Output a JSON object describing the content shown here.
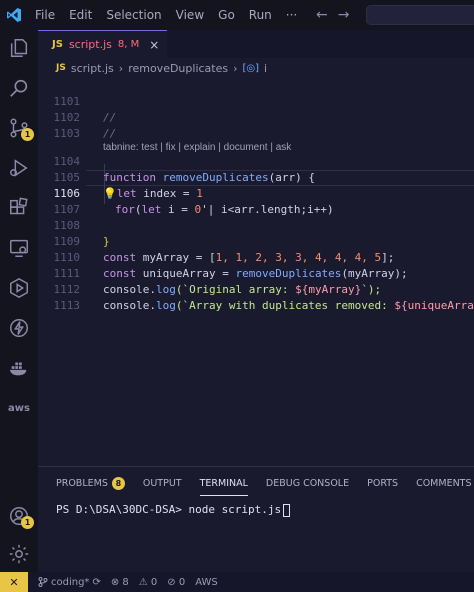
{
  "menu": [
    "File",
    "Edit",
    "Selection",
    "View",
    "Go",
    "Run",
    "···"
  ],
  "title_nav": {
    "back": "←",
    "forward": "→"
  },
  "activity": {
    "source_control_badge": "1",
    "accounts_badge": "1",
    "aws_label": "aws"
  },
  "tab": {
    "lang": "JS",
    "name": "script.js",
    "meta": "8, M",
    "close": "×"
  },
  "breadcrumb": {
    "lang": "JS",
    "file": "script.js",
    "sep1": "›",
    "func": "removeDuplicates",
    "sep2": "›",
    "sym_icon": "[◎]",
    "sym": "i"
  },
  "hint_line": "tabnine: test | fix | explain | document | ask",
  "lines": {
    "l1101": "1101",
    "l1102": "1102",
    "l1103": "1103",
    "l1104": "1104",
    "l1105": "1105",
    "l1106": "1106",
    "l1107": "1107",
    "l1108": "1108",
    "l1109": "1109",
    "l1110": "1110",
    "l1111": "1111",
    "l1112": "1112",
    "l1113": "1113"
  },
  "code": {
    "c1101": "//",
    "c1102": "//",
    "c1104_kw": "function",
    "c1104_fn": "removeDuplicates",
    "c1104_rest": "(arr) {",
    "c1105_kw": "let",
    "c1105_var": " index = ",
    "c1105_num": "1",
    "c1106_kw": "for",
    "c1106_a": "(",
    "c1106_kw2": "let",
    "c1106_b": " i = ",
    "c1106_num": "0",
    "c1106_c": "'| i<arr.length;i++)",
    "c1108": "}",
    "c1109_kw": "const",
    "c1109_var": " myArray = [",
    "c1109_nums": "1, 1, 2, 3, 3, 4, 4, 4, 5",
    "c1109_end": "];",
    "c1110_kw": "const",
    "c1110_var": " uniqueArray = ",
    "c1110_fn": "removeDuplicates",
    "c1110_end": "(myArray);",
    "c1111_a": "console.",
    "c1111_fn": "log",
    "c1111_str": "(`Original array: ",
    "c1111_tmpl": "${myArray}",
    "c1111_end": "`);",
    "c1112_a": "console.",
    "c1112_fn": "log",
    "c1112_str": "(`Array with duplicates removed: ",
    "c1112_tmpl": "${uniqueArray}"
  },
  "panel": {
    "tabs": [
      "PROBLEMS",
      "OUTPUT",
      "TERMINAL",
      "DEBUG CONSOLE",
      "PORTS",
      "COMMENTS"
    ],
    "problems_count": "8",
    "terminal_line": "PS D:\\DSA\\30DC-DSA> node script.js"
  },
  "status": {
    "remote": "✕",
    "branch": "coding*",
    "sync": "⟳",
    "errors": "⊗ 8",
    "warnings": "⚠ 0",
    "ports": "⊘ 0",
    "aws": "AWS"
  },
  "colors": {
    "accent": "#e8c547",
    "keyword": "#c792ea",
    "function": "#82aaff",
    "number": "#f78c6c"
  }
}
